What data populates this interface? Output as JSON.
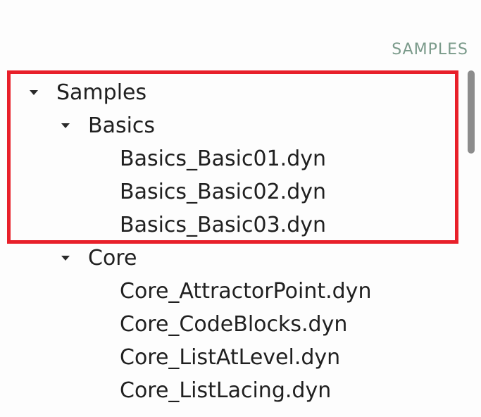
{
  "panel": {
    "header": "SAMPLES"
  },
  "tree": {
    "root": {
      "label": "Samples",
      "groups": [
        {
          "label": "Basics",
          "files": [
            "Basics_Basic01.dyn",
            "Basics_Basic02.dyn",
            "Basics_Basic03.dyn"
          ]
        },
        {
          "label": "Core",
          "files": [
            "Core_AttractorPoint.dyn",
            "Core_CodeBlocks.dyn",
            "Core_ListAtLevel.dyn",
            "Core_ListLacing.dyn"
          ]
        }
      ]
    }
  },
  "icons": {
    "expanded": "caret-down-icon"
  },
  "colors": {
    "header_text": "#7a9a8a",
    "highlight_border": "#e8202a",
    "item_text": "#202020",
    "scrollbar_thumb": "#8c8c8c"
  }
}
